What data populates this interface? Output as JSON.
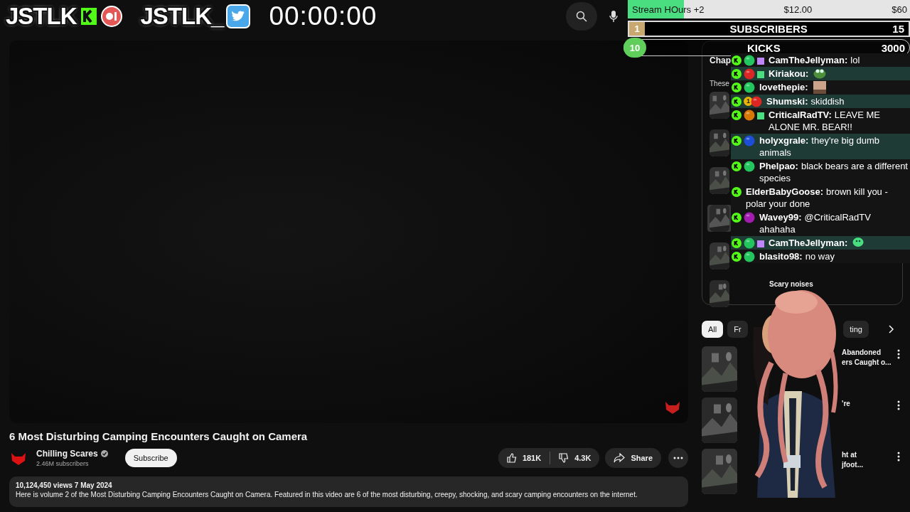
{
  "header": {
    "logos": [
      {
        "text": "JSTLK",
        "kind": "kick"
      },
      {
        "text": "JSTLK_",
        "kind": "twitter"
      }
    ],
    "timer": "00:00:00"
  },
  "goals": {
    "bar": {
      "label": "Stream HOurs +2",
      "amount": "$12.00",
      "target": "$60",
      "level": 0.2
    },
    "subscribers": {
      "badge": "1",
      "label": "SUBSCRIBERS",
      "value": "15"
    },
    "kicks": {
      "badge": "10",
      "label": "KICKS",
      "value": "3000"
    }
  },
  "video": {
    "title": "6 Most Disturbing Camping Encounters Caught on Camera",
    "channel": {
      "name": "Chilling Scares",
      "verified": true,
      "subscribers": "2.46M subscribers"
    },
    "subscribe": "Subscribe",
    "likes": "181K",
    "dislikes": "4.3K",
    "share": "Share",
    "description": {
      "meta": "10,124,450 views  7 May 2024",
      "text": "Here is volume 2 of the Most Disturbing Camping Encounters Caught on Camera. Featured in this video are 6 of the most disturbing, creepy, shocking, and scary camping encounters on the internet."
    }
  },
  "chapters": {
    "title": "Chap",
    "subtitle": "These",
    "items": [
      {
        "kind": "picture"
      },
      {
        "kind": "picture"
      },
      {
        "kind": "picture"
      },
      {
        "kind": "picture",
        "selected": true
      },
      {
        "kind": "picture"
      },
      {
        "kind": "picture",
        "title": "Scary noises"
      }
    ]
  },
  "chips": [
    {
      "label": "All",
      "selected": true
    },
    {
      "label": "Fr",
      "selected": false
    },
    {
      "label": "ting",
      "selected": false
    }
  ],
  "recommended": [
    {
      "title_lines": [
        "Abandoned",
        "ers Caught o..."
      ]
    },
    {
      "title_lines": [
        "'re"
      ]
    },
    {
      "title_lines": [
        "ht at",
        "jfoot..."
      ]
    }
  ],
  "chat": [
    {
      "user": "CamTheJellyman:",
      "text": "lol",
      "color": "#22c55e",
      "gift": {
        "color": "#c084fc"
      },
      "highlighted": false
    },
    {
      "user": "Kiriakou:",
      "emote": {
        "kind": "frog"
      },
      "color": "#dc2626",
      "gift": {
        "color": "#4ade80"
      },
      "highlighted": true
    },
    {
      "user": "lovethepie:",
      "emote": {
        "kind": "face"
      },
      "color": "#22c55e",
      "highlighted": false
    },
    {
      "user": "Shumski:",
      "text": "skiddish",
      "badge": "1",
      "color": "#dc2626",
      "highlighted": true
    },
    {
      "user": "CriticalRadTV:",
      "text": "LEAVE ME ALONE MR. BEAR!!",
      "color": "#d97706",
      "gift": {
        "color": "#4ade80"
      },
      "highlighted": false
    },
    {
      "user": "holyxgrale:",
      "text": "they're big dumb animals",
      "color": "#1d4ed8",
      "highlighted": true
    },
    {
      "user": "Phelpao:",
      "text": "black bears are a different species",
      "color": "#22c55e",
      "highlighted": false
    },
    {
      "user": "ElderBabyGoose:",
      "text": "brown kill you - polar your done",
      "highlighted": false
    },
    {
      "user": "Wavey99:",
      "text": "@CriticalRadTV ahahaha",
      "color": "#a21caf",
      "highlighted": false
    },
    {
      "user": "CamTheJellyman:",
      "emote": {
        "kind": "blob"
      },
      "color": "#22c55e",
      "gift": {
        "color": "#c084fc"
      },
      "highlighted": true
    },
    {
      "user": "blasito98:",
      "text": "no way",
      "color": "#22c55e",
      "highlighted": false
    }
  ]
}
